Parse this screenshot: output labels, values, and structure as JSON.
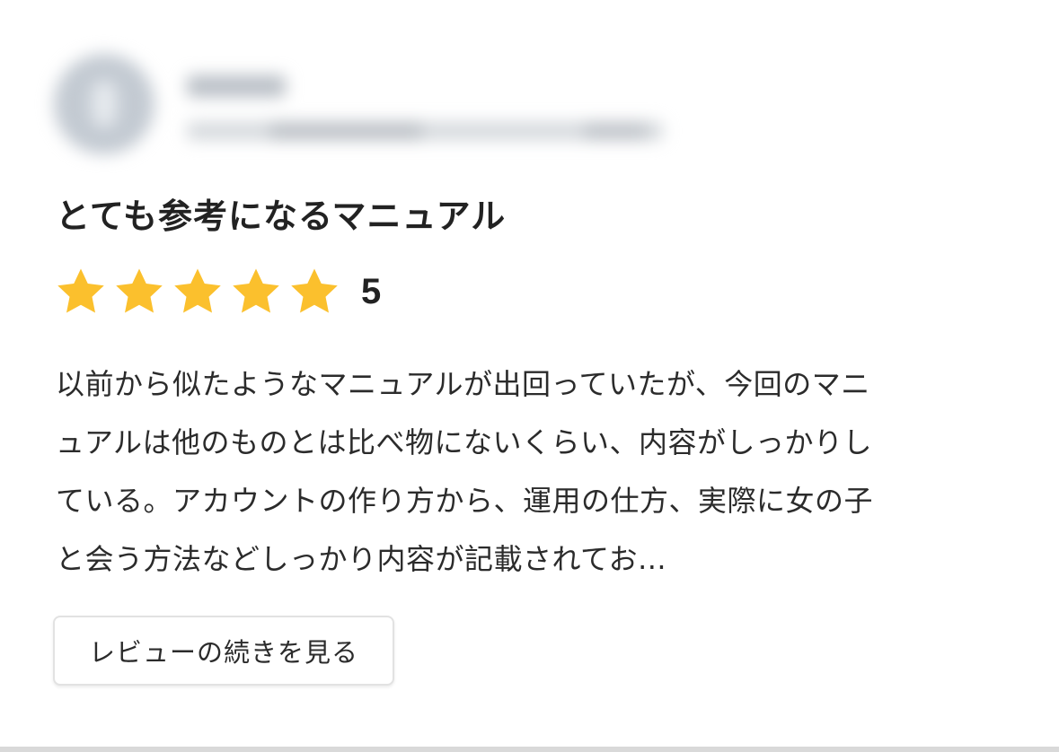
{
  "review": {
    "title": "とても参考になるマニュアル",
    "rating": {
      "stars": 5,
      "max": 5,
      "value_label": "5",
      "star_color": "#fbc02d"
    },
    "body_lines": [
      "以前から似たようなマニュアルが出回っていたが、今回のマニ",
      "ュアルは他のものとは比べ物にないくらい、内容がしっかりし",
      "ている。アカウントの作り方から、運用の仕方、実際に女の子",
      "と会う方法などしっかり内容が記載されてお..."
    ],
    "read_more_label": "レビューの続きを見る"
  }
}
